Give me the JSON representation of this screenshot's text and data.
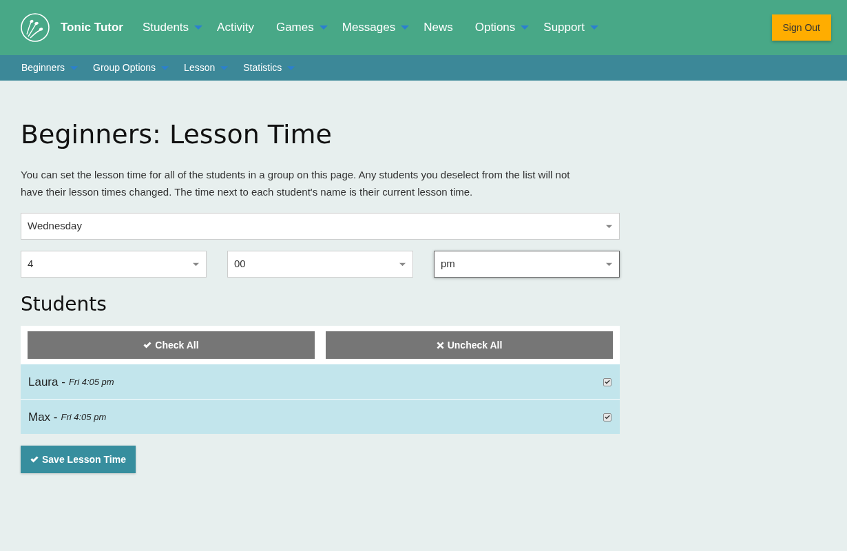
{
  "header": {
    "brand": "Tonic Tutor",
    "nav": [
      {
        "label": "Students",
        "dropdown": true
      },
      {
        "label": "Activity",
        "dropdown": false
      },
      {
        "label": "Games",
        "dropdown": true
      },
      {
        "label": "Messages",
        "dropdown": true
      },
      {
        "label": "News",
        "dropdown": false
      },
      {
        "label": "Options",
        "dropdown": true
      },
      {
        "label": "Support",
        "dropdown": true
      }
    ],
    "sign_out": "Sign Out"
  },
  "subnav": [
    {
      "label": "Beginners",
      "dropdown": true
    },
    {
      "label": "Group Options",
      "dropdown": true
    },
    {
      "label": "Lesson",
      "dropdown": true
    },
    {
      "label": "Statistics",
      "dropdown": true
    }
  ],
  "title": "Beginners: Lesson Time",
  "description": "You can set the lesson time for all of the students in a group on this page. Any students you deselect from the list will not have their lesson times changed. The time next to each student's name is their current lesson time.",
  "day_select": {
    "value": "Wednesday",
    "focused": false
  },
  "time_selects": [
    {
      "value": "4",
      "focused": false
    },
    {
      "value": "00",
      "focused": false
    },
    {
      "value": "pm",
      "focused": true
    }
  ],
  "students_heading": "Students",
  "bulk_buttons": [
    {
      "kind": "check",
      "label": "Check All"
    },
    {
      "kind": "uncheck",
      "label": "Uncheck All"
    }
  ],
  "students": [
    {
      "label": "Laura -",
      "time": "Fri 4:05 pm",
      "checked": true
    },
    {
      "label": "Max -",
      "time": "Fri 4:05 pm",
      "checked": true
    }
  ],
  "save_button": "Save Lesson Time"
}
